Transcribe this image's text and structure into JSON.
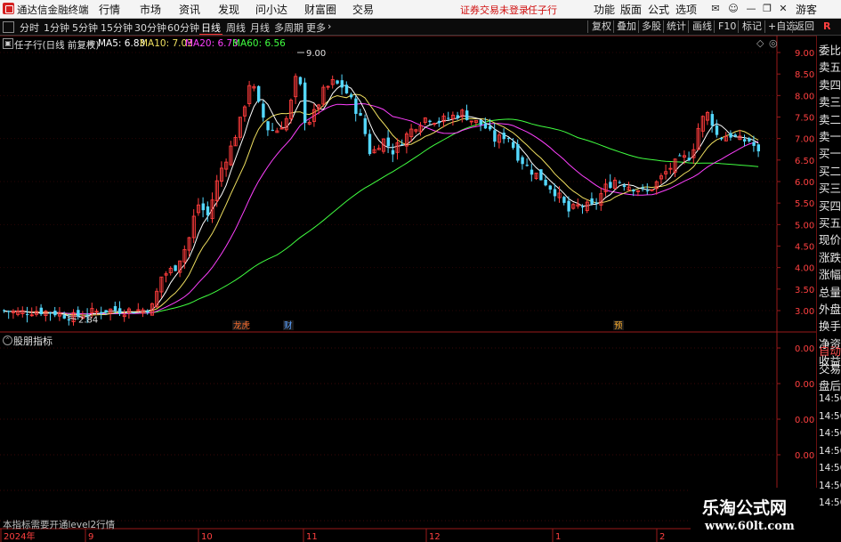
{
  "titlebar": {
    "app_name": "通达信金融终端",
    "menu": [
      "行情",
      "市场",
      "资讯",
      "发现",
      "问小达",
      "财富圈",
      "交易"
    ],
    "notice": "证券交易未登录",
    "stock_name": "任子行",
    "right_menu": [
      "功能",
      "版面",
      "公式",
      "选项"
    ],
    "guest": "游客"
  },
  "toolbar": {
    "timeframes": [
      "分时",
      "1分钟",
      "5分钟",
      "15分钟",
      "30分钟",
      "60分钟",
      "日线",
      "周线",
      "月线",
      "多周期",
      "更多"
    ],
    "active_timeframe": "日线",
    "tools": [
      "复权",
      "叠加",
      "多股",
      "统计",
      "画线",
      "F10",
      "标记",
      "+自选",
      "返回"
    ]
  },
  "chart": {
    "title": "任子行(日线 前复权)",
    "ma_legend": [
      {
        "label": "MA5: 6.83",
        "color": "#ffffff"
      },
      {
        "label": "MA10: 7.03",
        "color": "#f0e060"
      },
      {
        "label": "MA20: 6.73",
        "color": "#ff40ff"
      },
      {
        "label": "MA60: 6.56",
        "color": "#40ff40"
      }
    ],
    "price_ticks": [
      "9.00",
      "8.50",
      "8.00",
      "7.50",
      "7.00",
      "6.50",
      "6.00",
      "5.50",
      "5.00",
      "4.50",
      "4.00",
      "3.50",
      "3.00"
    ],
    "high_label": "9.00",
    "low_label": "2.84",
    "event_markers": [
      "龙虎",
      "财",
      "预"
    ],
    "indicator_title": "股朋指标",
    "indicator_ticks": [
      "0.00",
      "0.00",
      "0.00",
      "0.00",
      "0.00",
      "0.00"
    ],
    "indicator_notice": "本指标需要开通level2行情",
    "date_labels": [
      "2024年",
      "9",
      "10",
      "11",
      "12",
      "1",
      "2"
    ]
  },
  "right_panel": {
    "labels": [
      "委比",
      "卖五",
      "卖四",
      "卖三",
      "卖二",
      "卖一",
      "买一",
      "买二",
      "买三",
      "买四",
      "买五",
      "现价",
      "涨跌",
      "涨幅",
      "总量",
      "外盘",
      "换手",
      "净资",
      "收益"
    ],
    "lower": [
      "自动",
      "交易",
      "盘后"
    ],
    "times": [
      "14:56",
      "14:56",
      "14:56",
      "14:56",
      "14:56",
      "14:56",
      "14:56"
    ]
  },
  "watermark": {
    "name": "乐淘公式网",
    "url": "www.60lt.com"
  },
  "colors": {
    "up": "#ff3c3c",
    "down": "#54d8ff",
    "axis_red": "#9a1a1a",
    "ma5": "#ffffff",
    "ma10": "#f0e060",
    "ma20": "#ff40ff",
    "ma60": "#40ff40"
  }
}
